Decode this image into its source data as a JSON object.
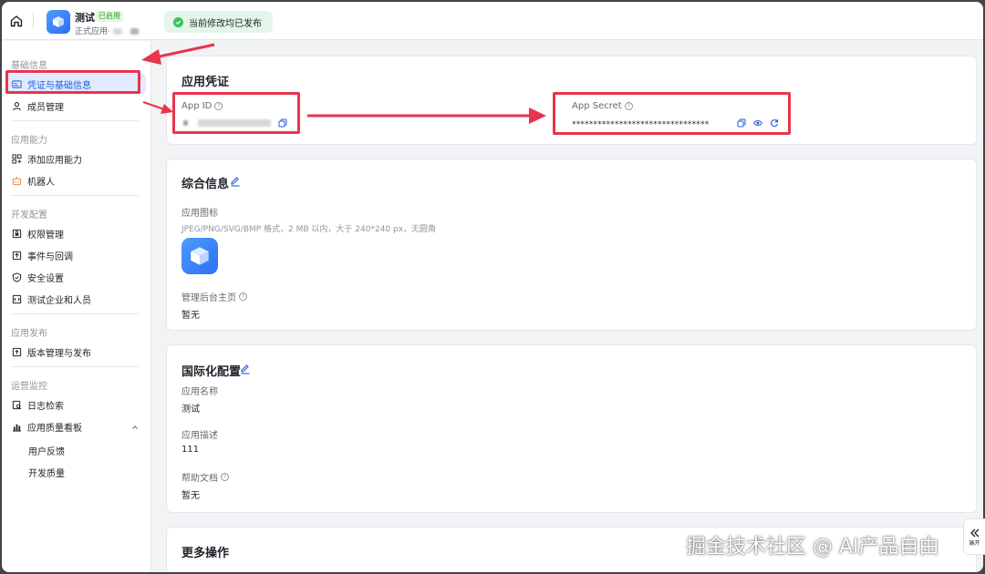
{
  "header": {
    "app_name": "测试",
    "app_badge": "已启用",
    "app_sub": "正式应用·",
    "toast": "当前修改均已发布"
  },
  "sidebar": {
    "groups": [
      "基础信息",
      "应用能力",
      "开发配置",
      "应用发布",
      "运营监控"
    ],
    "items": [
      {
        "label": "凭证与基础信息",
        "icon": "id-card-icon"
      },
      {
        "label": "成员管理",
        "icon": "user-icon"
      },
      {
        "label": "添加应用能力",
        "icon": "grid-plus-icon"
      },
      {
        "label": "机器人",
        "icon": "robot-icon"
      },
      {
        "label": "权限管理",
        "icon": "lock-box-icon"
      },
      {
        "label": "事件与回调",
        "icon": "event-icon"
      },
      {
        "label": "安全设置",
        "icon": "shield-icon"
      },
      {
        "label": "测试企业和人员",
        "icon": "code-box-icon"
      },
      {
        "label": "版本管理与发布",
        "icon": "upload-icon"
      },
      {
        "label": "日志检索",
        "icon": "log-search-icon"
      },
      {
        "label": "应用质量看板",
        "icon": "bar-chart-icon"
      }
    ],
    "subitems": [
      "用户反馈",
      "开发质量"
    ]
  },
  "credentials": {
    "title": "应用凭证",
    "app_id_label": "App ID",
    "app_secret_label": "App Secret",
    "app_secret_value": "********************************"
  },
  "general": {
    "title": "综合信息",
    "icon_label": "应用图标",
    "icon_hint": "JPEG/PNG/SVG/BMP 格式，2 MB 以内，大于 240*240 px，无圆角",
    "homepage_label": "管理后台主页",
    "homepage_value": "暂无"
  },
  "i18n": {
    "title": "国际化配置",
    "name_label": "应用名称",
    "name_value": "测试",
    "desc_label": "应用描述",
    "desc_value": "111",
    "doc_label": "帮助文档",
    "doc_value": "暂无"
  },
  "more": {
    "title": "更多操作"
  },
  "expand_label": "展开",
  "watermark": "掘金技术社区 @ AI产品自由",
  "colors": {
    "accent": "#245bdb",
    "annotation_red": "#e8344d",
    "success": "#34c759"
  }
}
